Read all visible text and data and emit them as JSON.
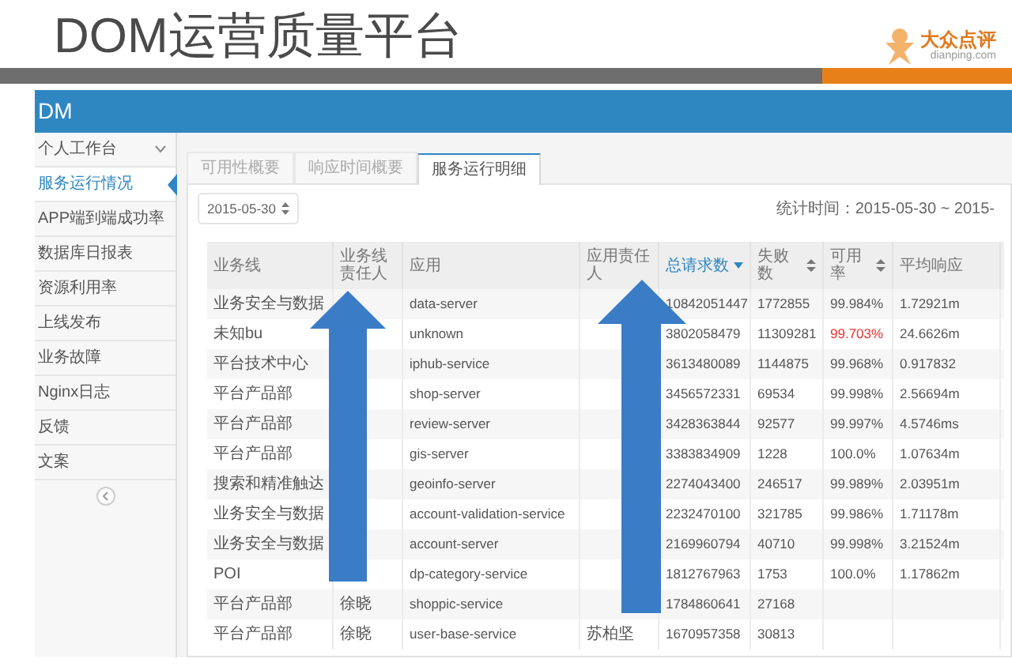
{
  "slide": {
    "title": "DOM运营质量平台",
    "logo": {
      "name": "大众点评",
      "domain": "dianping.com"
    }
  },
  "app": {
    "brand": "DM",
    "sidebar": [
      {
        "label": "个人工作台",
        "kind": "group",
        "selected": false
      },
      {
        "label": "服务运行情况",
        "kind": "link",
        "selected": true
      },
      {
        "label": "APP端到端成功率",
        "kind": "link",
        "selected": false
      },
      {
        "label": "数据库日报表",
        "kind": "link",
        "selected": false
      },
      {
        "label": "资源利用率",
        "kind": "link",
        "selected": false
      },
      {
        "label": "上线发布",
        "kind": "link",
        "selected": false
      },
      {
        "label": "业务故障",
        "kind": "link",
        "selected": false
      },
      {
        "label": "Nginx日志",
        "kind": "link",
        "selected": false
      },
      {
        "label": "反馈",
        "kind": "link",
        "selected": false
      },
      {
        "label": "文案",
        "kind": "link",
        "selected": false
      }
    ],
    "tabs": [
      {
        "label": "可用性概要",
        "selected": false
      },
      {
        "label": "响应时间概要",
        "selected": false
      },
      {
        "label": "服务运行明细",
        "selected": true
      }
    ],
    "date_select": {
      "value": "2015-05-30"
    },
    "stat_time": "统计时间：2015-05-30 ~ 2015-",
    "table": {
      "columns": [
        {
          "label": "业务线",
          "sortable": false,
          "sorted": false
        },
        {
          "label": "业务线责任人",
          "sortable": false,
          "sorted": false
        },
        {
          "label": "应用",
          "sortable": false,
          "sorted": false
        },
        {
          "label": "应用责任人",
          "sortable": false,
          "sorted": false
        },
        {
          "label": "总请求数",
          "sortable": true,
          "sorted": true
        },
        {
          "label": "失败数",
          "sortable": true,
          "sorted": false
        },
        {
          "label": "可用率",
          "sortable": true,
          "sorted": false
        },
        {
          "label": "平均响应",
          "sortable": false,
          "sorted": false
        }
      ],
      "rows": [
        {
          "line": "业务安全与数据",
          "app": "data-server",
          "total": "10842051447",
          "failed": "1772855",
          "availability": {
            "text": "99.984%",
            "alert": false
          },
          "response": "1.72921m"
        },
        {
          "line": "未知bu",
          "app": "unknown",
          "total": "3802058479",
          "failed": "11309281",
          "availability": {
            "text": "99.703%",
            "alert": true
          },
          "response": "24.6626m"
        },
        {
          "line": "平台技术中心",
          "app": "iphub-service",
          "total": "3613480089",
          "failed": "1144875",
          "availability": {
            "text": "99.968%",
            "alert": false
          },
          "response": "0.917832"
        },
        {
          "line": "平台产品部",
          "app": "shop-server",
          "total": "3456572331",
          "failed": "69534",
          "availability": {
            "text": "99.998%",
            "alert": false
          },
          "response": "2.56694m"
        },
        {
          "line": "平台产品部",
          "app": "review-server",
          "total": "3428363844",
          "failed": "92577",
          "availability": {
            "text": "99.997%",
            "alert": false
          },
          "response": "4.5746ms"
        },
        {
          "line": "平台产品部",
          "app": "gis-server",
          "total": "3383834909",
          "failed": "1228",
          "availability": {
            "text": "100.0%",
            "alert": false
          },
          "response": "1.07634m"
        },
        {
          "line": "搜索和精准触达",
          "app": "geoinfo-server",
          "total": "2274043400",
          "failed": "246517",
          "availability": {
            "text": "99.989%",
            "alert": false
          },
          "response": "2.03951m"
        },
        {
          "line": "业务安全与数据",
          "app": "account-validation-service",
          "total": "2232470100",
          "failed": "321785",
          "availability": {
            "text": "99.986%",
            "alert": false
          },
          "response": "1.71178m"
        },
        {
          "line": "业务安全与数据",
          "app": "account-server",
          "total": "2169960794",
          "failed": "40710",
          "availability": {
            "text": "99.998%",
            "alert": false
          },
          "response": "3.21524m"
        },
        {
          "line": "POI",
          "app": "dp-category-service",
          "total": "1812767963",
          "failed": "1753",
          "availability": {
            "text": "100.0%",
            "alert": false
          },
          "response": "1.17862m"
        },
        {
          "line": "平台产品部",
          "line_owner": "徐晓",
          "app": "shoppic-service",
          "total": "1784860641",
          "failed": "27168"
        },
        {
          "line": "平台产品部",
          "line_owner": "徐晓",
          "app": "user-base-service",
          "app_owner": "苏柏坚",
          "total": "1670957358",
          "failed": "30813"
        }
      ]
    }
  }
}
